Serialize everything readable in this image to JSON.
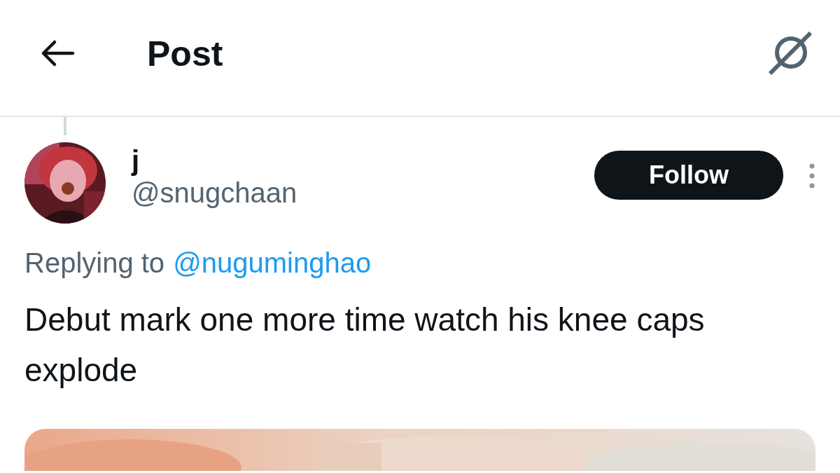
{
  "header": {
    "title": "Post"
  },
  "post": {
    "author": {
      "name": "j",
      "handle": "@snugchaan"
    },
    "follow_button": "Follow",
    "replying_to": {
      "prefix": "Replying to",
      "handle": "@nuguminghao"
    },
    "text": "Debut mark one more time watch his knee caps explode"
  }
}
